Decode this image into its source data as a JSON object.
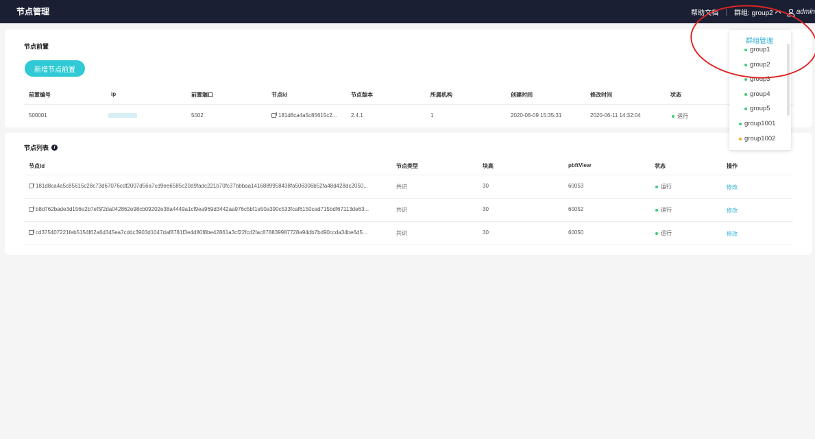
{
  "header": {
    "title": "节点管理",
    "help_label": "帮助文档",
    "group_label": "群组: group2",
    "user_label": "admin"
  },
  "frontend_card": {
    "title": "节点前置",
    "add_button": "新增节点前置",
    "columns": [
      "前置编号",
      "ip",
      "前置端口",
      "节点Id",
      "节点版本",
      "所属机构",
      "创建时间",
      "修改时间",
      "状态"
    ],
    "row": {
      "id": "500001",
      "ip": "",
      "port": "5002",
      "node_id": "181d8ca4a5c85615c2...",
      "version": "2.4.1",
      "org": "1",
      "created": "2020-06-09 15:35:31",
      "modified": "2020-06-11 14:32:04",
      "status": "运行"
    }
  },
  "node_card": {
    "title": "节点列表",
    "columns": [
      "节点Id",
      "节点类型",
      "块高",
      "pbftView",
      "状态",
      "操作"
    ],
    "rows": [
      {
        "node_id": "181d8ca4a5c85615c28c73d67076cdf2007d56a7cd9ee6585c20d9fadc221b70fc37bbbaa1416889958438fa506306b52fa48d428dc2050...",
        "type": "共识",
        "height": "30",
        "view": "60053",
        "status": "运行",
        "action": "修改"
      },
      {
        "node_id": "b8d762bade3d156e2b7ef5f2da042862e98cb09202e38a4449a1cf9ea969d3442aa976c5bf1e50a390c533fcaf6150cad715bdf67113de63...",
        "type": "共识",
        "height": "30",
        "view": "60052",
        "status": "运行",
        "action": "修改"
      },
      {
        "node_id": "cd375407221feb5154f62a6d345ea7cddc3903d1047daf8781f3e4d80f8be42861a3cf22fcd2fac878839987728a94db7bd90ccda34be6d5...",
        "type": "共识",
        "height": "30",
        "view": "60050",
        "status": "运行",
        "action": "修改"
      }
    ]
  },
  "group_dropdown": {
    "title": "群组管理",
    "items": [
      {
        "label": "group1",
        "color": "#3fcb7e"
      },
      {
        "label": "group2",
        "color": "#3fcb7e"
      },
      {
        "label": "group3",
        "color": "#3fcb7e"
      },
      {
        "label": "group4",
        "color": "#3fcb7e"
      },
      {
        "label": "group5",
        "color": "#3fcb7e"
      },
      {
        "label": "group1001",
        "color": "#3fcb7e"
      },
      {
        "label": "group1002",
        "color": "#f5a623"
      }
    ]
  },
  "colors": {
    "header_bg": "#1b1f33",
    "accent": "#2fcad5",
    "link": "#2fb0d5",
    "status_running": "#3fcb7e",
    "annotation": "#e02424"
  }
}
